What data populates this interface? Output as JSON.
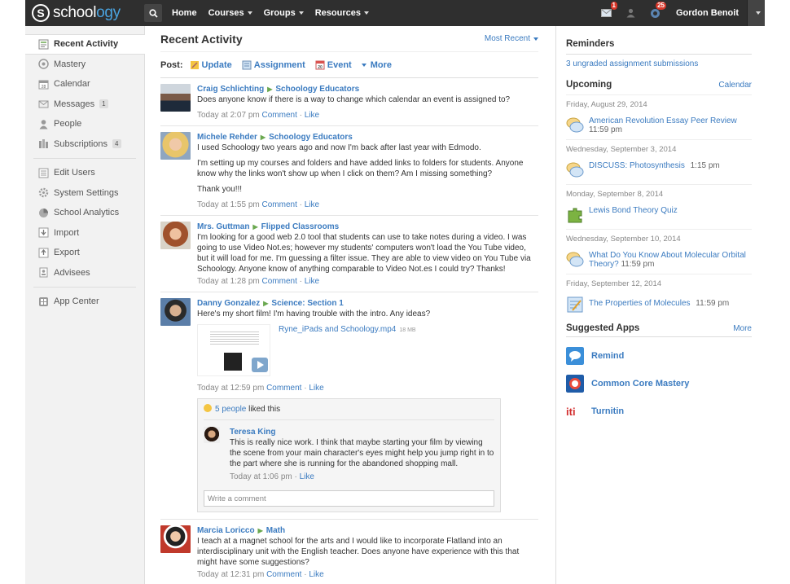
{
  "topbar": {
    "logo_text": "schoology",
    "nav": [
      {
        "label": "Home",
        "has_menu": false
      },
      {
        "label": "Courses",
        "has_menu": true
      },
      {
        "label": "Groups",
        "has_menu": true
      },
      {
        "label": "Resources",
        "has_menu": true
      }
    ],
    "messages_badge": "1",
    "notifications_badge": "25",
    "user_name": "Gordon Benoit",
    "colors": {
      "bar": "#2f2f2f",
      "badge": "#d9372a",
      "link": "#3b7bc0"
    }
  },
  "sidebar": {
    "items": [
      {
        "label": "Recent Activity",
        "icon": "recent-activity-icon",
        "active": true
      },
      {
        "label": "Mastery",
        "icon": "mastery-icon"
      },
      {
        "label": "Calendar",
        "icon": "calendar-icon"
      },
      {
        "label": "Messages",
        "icon": "messages-icon",
        "count": "1"
      },
      {
        "label": "People",
        "icon": "people-icon"
      },
      {
        "label": "Subscriptions",
        "icon": "subscriptions-icon",
        "count": "4"
      },
      {
        "label": "Edit Users",
        "icon": "edit-users-icon"
      },
      {
        "label": "System Settings",
        "icon": "settings-icon"
      },
      {
        "label": "School Analytics",
        "icon": "analytics-icon"
      },
      {
        "label": "Import",
        "icon": "import-icon"
      },
      {
        "label": "Export",
        "icon": "export-icon"
      },
      {
        "label": "Advisees",
        "icon": "advisees-icon"
      },
      {
        "label": "App Center",
        "icon": "app-center-icon"
      }
    ]
  },
  "main": {
    "title": "Recent Activity",
    "sort": "Most Recent",
    "post_label": "Post:",
    "post_options": [
      "Update",
      "Assignment",
      "Event",
      "More"
    ],
    "feed": [
      {
        "author": "Craig Schlichting",
        "group": "Schoology Educators",
        "paragraphs": [
          "Does anyone know if there is a way to change which calendar an event is assigned to?"
        ],
        "time": "Today at 2:07 pm"
      },
      {
        "author": "Michele Rehder",
        "group": "Schoology Educators",
        "paragraphs": [
          "I used Schoology two years ago and now I'm back after last year with Edmodo.",
          "I'm setting up my courses and folders and have added links to folders for students. Anyone know why the links won't show up when I click on them? Am I missing something?",
          "Thank you!!!"
        ],
        "time": "Today at 1:55 pm"
      },
      {
        "author": "Mrs. Guttman",
        "group": "Flipped Classrooms",
        "paragraphs": [
          "I'm looking for a good web 2.0 tool that students can use to take notes during a video.  I was going to use Video Not.es; however my students' computers won't load the You Tube video, but it will load for me.  I'm guessing a filter issue.  They are able to view video on You Tube via Schoology.  Anyone know of anything comparable to Video Not.es I could try?  Thanks!"
        ],
        "time": "Today at 1:28 pm"
      },
      {
        "author": "Danny Gonzalez",
        "group": "Science: Section 1",
        "paragraphs": [
          "Here's my short film! I'm having trouble with the intro. Any ideas?"
        ],
        "attachment": {
          "name": "Ryne_iPads and Schoology.mp4",
          "size": "18 MB"
        },
        "time": "Today at 12:59 pm",
        "likes_count": "5 people",
        "likes_suffix": "liked this",
        "comment": {
          "author": "Teresa King",
          "text": "This is really nice work. I think that maybe starting your film by viewing the scene from your main character's eyes might help you jump right in to the part where she is running for the abandoned shopping mall.",
          "time": "Today at 1:06 pm"
        },
        "comment_placeholder": "Write a comment"
      },
      {
        "author": "Marcia Loricco",
        "group": "Math",
        "paragraphs": [
          "I teach at a magnet school for the arts and I would like to incorporate Flatland into an interdisciplinary unit with the English teacher.  Does anyone have experience with this that might have some suggestions?"
        ],
        "time": "Today at 12:31 pm"
      }
    ],
    "comment_label": "Comment",
    "like_label": "Like"
  },
  "right": {
    "reminders_title": "Reminders",
    "reminder_link": "3 ungraded assignment submissions",
    "upcoming_title": "Upcoming",
    "calendar_link": "Calendar",
    "upcoming": [
      {
        "date": "Friday, August 29, 2014",
        "title": "American Revolution Essay Peer Review",
        "time": "11:59 pm",
        "icon": "discussion-icon"
      },
      {
        "date": "Wednesday, September 3, 2014",
        "title": "DISCUSS: Photosynthesis",
        "time": "1:15 pm",
        "icon": "discussion-icon"
      },
      {
        "date": "Monday, September 8, 2014",
        "title": "Lewis Bond Theory Quiz",
        "time": "",
        "icon": "quiz-puzzle-icon"
      },
      {
        "date": "Wednesday, September 10, 2014",
        "title": "What Do You Know About Molecular Orbital Theory?",
        "time": "11:59 pm",
        "icon": "discussion-icon"
      },
      {
        "date": "Friday, September 12, 2014",
        "title": "The Properties of Molecules",
        "time": "11:59 pm",
        "icon": "assignment-icon"
      }
    ],
    "apps_title": "Suggested Apps",
    "apps_more": "More",
    "apps": [
      {
        "name": "Remind",
        "icon": "remind-app-icon"
      },
      {
        "name": "Common Core Mastery",
        "icon": "common-core-app-icon"
      },
      {
        "name": "Turnitin",
        "icon": "turnitin-app-icon"
      }
    ]
  }
}
